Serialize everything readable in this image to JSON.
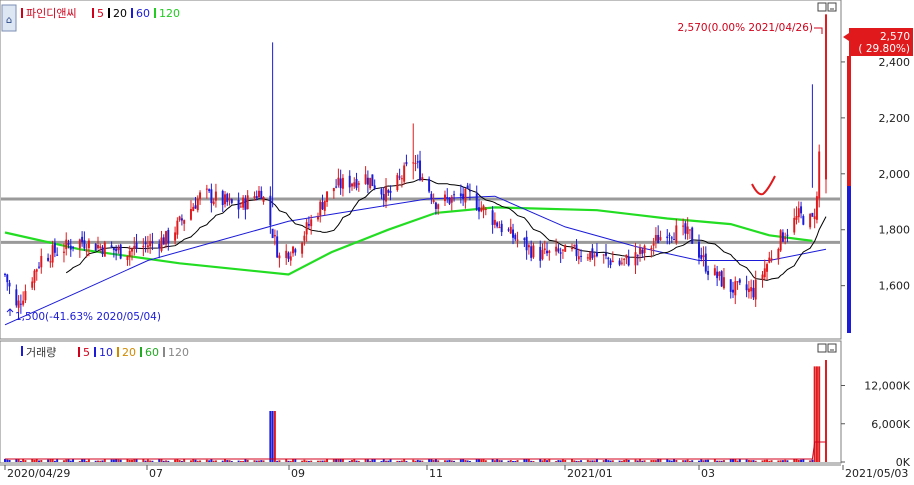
{
  "price_legend": {
    "title": "파인디앤씨",
    "ma": [
      {
        "label": "5",
        "color": "#d0021b"
      },
      {
        "label": "20",
        "color": "#000000"
      },
      {
        "label": "60",
        "color": "#1b1bd8"
      },
      {
        "label": "120",
        "color": "#22cc22"
      }
    ]
  },
  "volume_legend": {
    "title": "거래량",
    "ma": [
      {
        "label": "5",
        "color": "#d0021b"
      },
      {
        "label": "10",
        "color": "#1b1bd8"
      },
      {
        "label": "20",
        "color": "#d08a00"
      },
      {
        "label": "60",
        "color": "#22aa22"
      },
      {
        "label": "120",
        "color": "#888888"
      }
    ]
  },
  "annotations": {
    "high": "2,570(0.00% 2021/04/26)",
    "low": "1,500(-41.63% 2020/05/04)",
    "last_price": "2,570",
    "last_change": "( 29.80%)"
  },
  "price_axis_labels": [
    "2,400",
    "2,200",
    "2,000",
    "1,800",
    "1,600"
  ],
  "volume_axis_labels": [
    "12,000K",
    "6,000K",
    "0K"
  ],
  "date_labels": [
    "2020/04/29",
    "07",
    "09",
    "11",
    "2021/01",
    "03",
    "2021/05/03"
  ],
  "colors": {
    "up": "#e0191c",
    "down": "#1b1bd8",
    "ma120": "#22dd22",
    "support": "#9a9a9a"
  },
  "chart_data": [
    {
      "type": "candlestick",
      "title": "파인디앤씨",
      "ylim": [
        1420,
        2600
      ],
      "x_range": [
        "2020-04-29",
        "2021-04-26"
      ],
      "y_ticks": [
        1600,
        1800,
        2000,
        2200,
        2400
      ],
      "grid": false,
      "horizontal_levels": [
        1910,
        1755
      ],
      "high_point": {
        "date": "2021/04/26",
        "value": 2570
      },
      "low_point": {
        "date": "2020/05/04",
        "value": 1500
      },
      "anchors": [
        {
          "date": "2020-04-29",
          "close": 1640
        },
        {
          "date": "2020-05-04",
          "close": 1520
        },
        {
          "date": "2020-05-15",
          "close": 1700
        },
        {
          "date": "2020-06-01",
          "close": 1760
        },
        {
          "date": "2020-06-20",
          "close": 1720
        },
        {
          "date": "2020-07-10",
          "close": 1770
        },
        {
          "date": "2020-07-25",
          "close": 1930
        },
        {
          "date": "2020-08-10",
          "close": 1880
        },
        {
          "date": "2020-08-20",
          "close": 1940
        },
        {
          "date": "2020-08-28",
          "close": 1700
        },
        {
          "date": "2020-09-05",
          "close": 1750
        },
        {
          "date": "2020-09-20",
          "close": 1950
        },
        {
          "date": "2020-10-05",
          "close": 1990
        },
        {
          "date": "2020-10-15",
          "close": 1920
        },
        {
          "date": "2020-10-26",
          "close": 2050
        },
        {
          "date": "2020-11-05",
          "close": 1900
        },
        {
          "date": "2020-11-20",
          "close": 1920
        },
        {
          "date": "2020-12-05",
          "close": 1800
        },
        {
          "date": "2020-12-20",
          "close": 1710
        },
        {
          "date": "2021-01-10",
          "close": 1720
        },
        {
          "date": "2021-01-25",
          "close": 1680
        },
        {
          "date": "2021-02-05",
          "close": 1720
        },
        {
          "date": "2021-02-15",
          "close": 1800
        },
        {
          "date": "2021-02-25",
          "close": 1780
        },
        {
          "date": "2021-03-05",
          "close": 1660
        },
        {
          "date": "2021-03-15",
          "close": 1590
        },
        {
          "date": "2021-03-25",
          "close": 1580
        },
        {
          "date": "2021-04-05",
          "close": 1760
        },
        {
          "date": "2021-04-14",
          "close": 1850
        },
        {
          "date": "2021-04-20",
          "close": 1830
        },
        {
          "date": "2021-04-22",
          "close": 1910
        },
        {
          "date": "2021-04-26",
          "close": 2570
        }
      ],
      "ma120": [
        {
          "date": "2020-04-29",
          "value": 1790
        },
        {
          "date": "2020-06-01",
          "value": 1730
        },
        {
          "date": "2020-07-15",
          "value": 1680
        },
        {
          "date": "2020-09-01",
          "value": 1640
        },
        {
          "date": "2020-09-20",
          "value": 1720
        },
        {
          "date": "2020-10-15",
          "value": 1800
        },
        {
          "date": "2020-11-05",
          "value": 1860
        },
        {
          "date": "2020-12-01",
          "value": 1880
        },
        {
          "date": "2021-01-15",
          "value": 1870
        },
        {
          "date": "2021-02-15",
          "value": 1840
        },
        {
          "date": "2021-03-15",
          "value": 1820
        },
        {
          "date": "2021-04-01",
          "value": 1780
        },
        {
          "date": "2021-04-20",
          "value": 1760
        }
      ],
      "ma60": [
        {
          "date": "2020-04-29",
          "value": 1460
        },
        {
          "date": "2020-06-01",
          "value": 1580
        },
        {
          "date": "2020-07-01",
          "value": 1690
        },
        {
          "date": "2020-08-01",
          "value": 1760
        },
        {
          "date": "2020-09-01",
          "value": 1830
        },
        {
          "date": "2020-10-01",
          "value": 1870
        },
        {
          "date": "2020-11-01",
          "value": 1910
        },
        {
          "date": "2020-12-01",
          "value": 1920
        },
        {
          "date": "2021-01-01",
          "value": 1810
        },
        {
          "date": "2021-02-01",
          "value": 1740
        },
        {
          "date": "2021-03-01",
          "value": 1690
        },
        {
          "date": "2021-04-01",
          "value": 1690
        },
        {
          "date": "2021-04-26",
          "value": 1730
        }
      ]
    },
    {
      "type": "bar",
      "title": "거래량",
      "ylabel": "",
      "ylim": [
        0,
        16000
      ],
      "y_ticks": [
        0,
        6000,
        12000
      ],
      "spikes": [
        {
          "date": "2020-08-25",
          "value": 8000
        },
        {
          "date": "2021-04-22",
          "value": 15000
        },
        {
          "date": "2021-04-26",
          "value": 16000
        }
      ]
    }
  ]
}
